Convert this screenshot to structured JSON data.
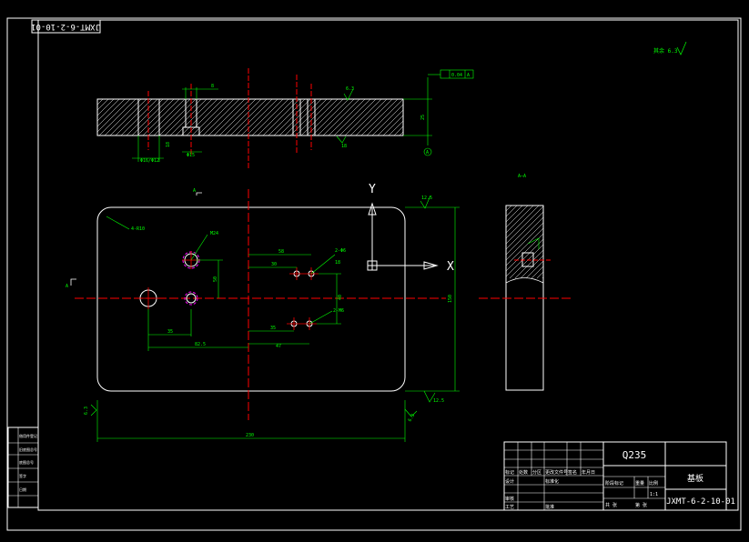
{
  "drawing_number_rotated": "JXMT-6-2-10-01",
  "material": "Q235",
  "part_name": "基板",
  "drawing_number": "JXMT-6-2-10-01",
  "section_mark": "A",
  "view_label_side": "A—A",
  "roughness_note": "其余 6.3",
  "axes": {
    "x": "X",
    "y": "Y"
  },
  "dims": {
    "top_width": "8",
    "top_depth": "18",
    "hole1": "Φ16/Φ12",
    "hole2": "Φ15",
    "thickness": "25",
    "chamfer": "6.3",
    "corner_radius": "4-R10",
    "m24": "M24",
    "two_phi6": "2-Φ6",
    "holes_2m6": "2-M6",
    "d58": "58",
    "d30": "30",
    "d50": "50",
    "d18": "18",
    "d35a": "35",
    "d35b": "35",
    "d47": "47",
    "d825": "82.5",
    "d40": "40",
    "height": "150",
    "width": "230",
    "r125": "12.5",
    "r63a": "6.3",
    "r63b": "6.3",
    "r125b": "12.5",
    "flatness": "0.04",
    "datum": "A"
  },
  "title_block": {
    "labels": [
      "标记",
      "处数",
      "分区",
      "更改文件号",
      "签名",
      "年月日",
      "设计",
      "标准化",
      "审核",
      "工艺",
      "批准",
      "阶段标记",
      "重量",
      "比例",
      "共 张",
      "第 张"
    ],
    "scale": "1:1"
  },
  "left_block": [
    "借用件登记",
    "旧底图总号",
    "底图总号",
    "签字",
    "日期"
  ]
}
